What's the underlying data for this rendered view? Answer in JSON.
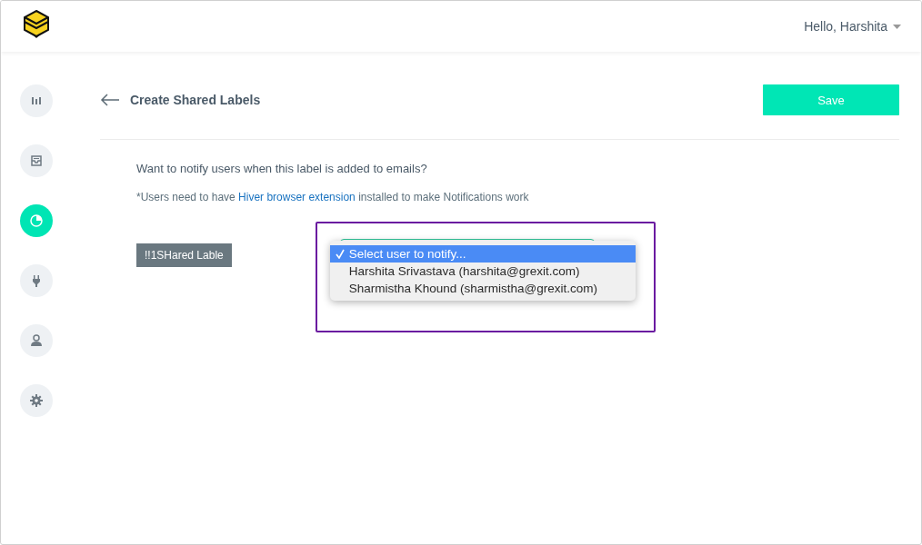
{
  "header": {
    "greeting": "Hello, Harshita"
  },
  "sidebar": {
    "items": [
      {
        "kind": "chart",
        "selected": false
      },
      {
        "kind": "inbox",
        "selected": false
      },
      {
        "kind": "label",
        "selected": true
      },
      {
        "kind": "plug",
        "selected": false
      },
      {
        "kind": "user",
        "selected": false
      },
      {
        "kind": "gear",
        "selected": false
      }
    ]
  },
  "page": {
    "title": "Create Shared Labels",
    "save_button": "Save"
  },
  "notify": {
    "question": "Want to notify users when this label is added to emails?",
    "note_before": "*Users need to have ",
    "note_link": "Hiver browser extension",
    "note_after": " installed to make Notifications work",
    "label_chip": "!!1SHared Lable",
    "options": [
      {
        "text": "Select user to notify...",
        "selected": true
      },
      {
        "text": "Harshita Srivastava (harshita@grexit.com)",
        "selected": false
      },
      {
        "text": "Sharmistha Khound (sharmistha@grexit.com)",
        "selected": false
      }
    ]
  }
}
